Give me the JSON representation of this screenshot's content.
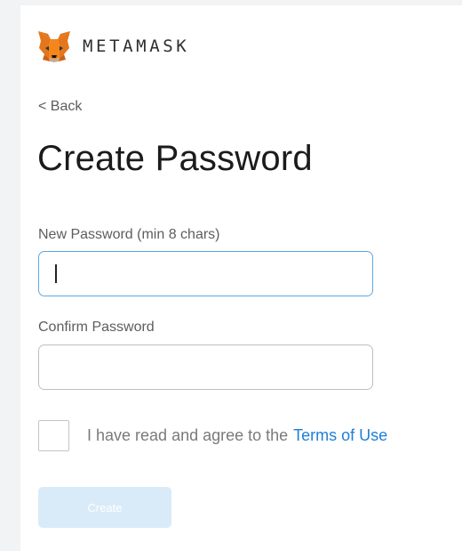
{
  "brand": {
    "name": "METAMASK",
    "logo_icon": "metamask-fox-icon"
  },
  "nav": {
    "back_label": "< Back"
  },
  "page": {
    "title": "Create Password"
  },
  "form": {
    "new_password": {
      "label": "New Password (min 8 chars)",
      "value": "",
      "placeholder": "",
      "focused": true
    },
    "confirm_password": {
      "label": "Confirm Password",
      "value": "",
      "placeholder": ""
    },
    "terms": {
      "checked": false,
      "text": "I have read and agree to the",
      "link_label": "Terms of Use"
    },
    "create_button": {
      "label": "Create",
      "enabled": false
    }
  },
  "colors": {
    "link": "#1f7fd4",
    "focus_border": "#5ea8e6",
    "button_disabled_bg": "#d9ebf8",
    "fox_orange": "#e2761b"
  }
}
